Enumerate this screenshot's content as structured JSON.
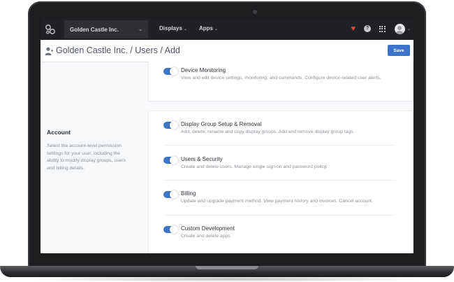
{
  "topnav": {
    "org_name": "Golden Castle Inc.",
    "menu_items": [
      {
        "label": "Displays"
      },
      {
        "label": "Apps"
      }
    ],
    "icons": [
      "logo-icon",
      "heart-icon",
      "help-icon",
      "app-grid-icon",
      "avatar"
    ]
  },
  "header": {
    "breadcrumb": "Golden Castle Inc. / Users / Add",
    "save_label": "Save"
  },
  "account_section": {
    "title": "Account",
    "description": "Select the account-level permission settings for your user, including the ability to modify display groups, users and billing details."
  },
  "permissions": [
    {
      "title": "Device Monitoring",
      "description": "View and edit device settings, monitoring, and commands. Configure device-related user alerts.",
      "enabled": true
    },
    {
      "title": "Display Group Setup & Removal",
      "description": "Add, delete, rename and copy display groups. Add and remove display group tags.",
      "enabled": true
    },
    {
      "title": "Users & Security",
      "description": "Create and delete users. Manage single sign-on and password policy.",
      "enabled": true
    },
    {
      "title": "Billing",
      "description": "Update and upgrade payment method. View payment history and invoices. Cancel account.",
      "enabled": true
    },
    {
      "title": "Custom Development",
      "description": "Create and delete apps.",
      "enabled": true
    }
  ],
  "colors": {
    "accent": "#3d74c7",
    "nav_bg": "#202124",
    "heart": "#e0474c"
  }
}
